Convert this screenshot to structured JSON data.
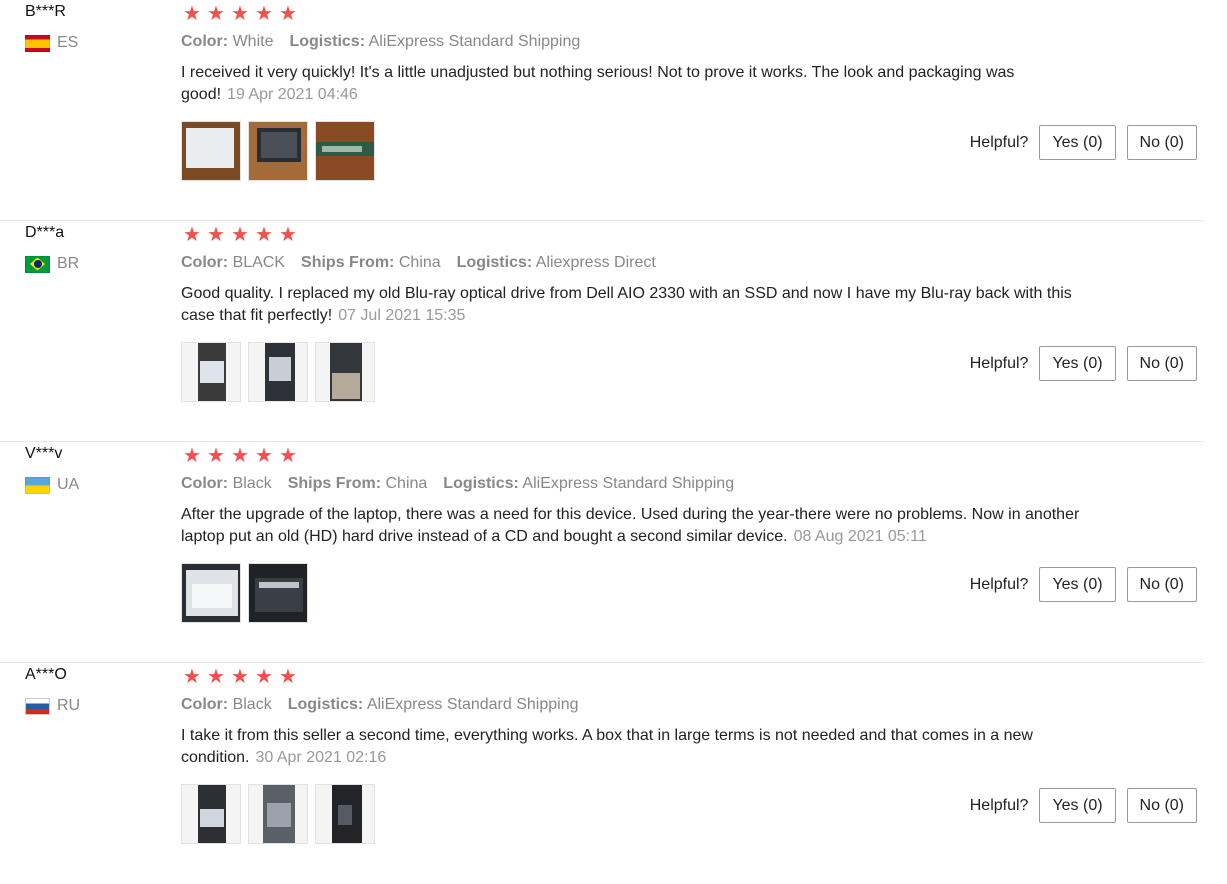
{
  "helpful_label": "Helpful?",
  "yes_label": "Yes (0)",
  "no_label": "No (0)",
  "star_glyph": "★",
  "reviews": [
    {
      "user": "B***R",
      "country": "ES",
      "flag": "es",
      "rating": 5,
      "attrs": [
        {
          "key": "Color:",
          "val": "White"
        },
        {
          "key": "Logistics:",
          "val": "AliExpress Standard Shipping"
        }
      ],
      "text": "I received it very quickly! It's a little unadjusted but nothing serious! Not to prove it works. The look and packaging was good!",
      "date": "19 Apr 2021 04:46",
      "thumb_icons": [
        "photo-white-drive-icon",
        "photo-drive-bay-icon",
        "photo-drive-connector-icon"
      ]
    },
    {
      "user": "D***a",
      "country": "BR",
      "flag": "br",
      "rating": 5,
      "attrs": [
        {
          "key": "Color:",
          "val": "BLACK"
        },
        {
          "key": "Ships From:",
          "val": "China"
        },
        {
          "key": "Logistics:",
          "val": "Aliexpress Direct"
        }
      ],
      "text": "Good quality. I replaced my old Blu-ray optical drive from Dell AIO 2330 with an SSD and now I have my Blu-ray back with this case that fit perfectly!",
      "date": "07 Jul 2021 15:35",
      "thumb_icons": [
        "photo-drive-box-icon",
        "photo-drive-angle-icon",
        "photo-drive-table-icon"
      ]
    },
    {
      "user": "V***v",
      "country": "UA",
      "flag": "ua",
      "rating": 5,
      "attrs": [
        {
          "key": "Color:",
          "val": "Black"
        },
        {
          "key": "Ships From:",
          "val": "China"
        },
        {
          "key": "Logistics:",
          "val": "AliExpress Standard Shipping"
        }
      ],
      "text": "After the upgrade of the laptop, there was a need for this device. Used during the year-there were no problems. Now in another laptop put an old (HD) hard drive instead of a CD and bought a second similar device.",
      "date": "08 Aug 2021 05:11",
      "thumb_icons": [
        "photo-drive-package-icon",
        "photo-drive-dark-box-icon"
      ]
    },
    {
      "user": "A***O",
      "country": "RU",
      "flag": "ru",
      "rating": 5,
      "attrs": [
        {
          "key": "Color:",
          "val": "Black"
        },
        {
          "key": "Logistics:",
          "val": "AliExpress Standard Shipping"
        }
      ],
      "text": "I take it from this seller a second time, everything works. A box that in large terms is not needed and that comes in a new condition.",
      "date": "30 Apr 2021 02:16",
      "thumb_icons": [
        "photo-drive-front-icon",
        "photo-drive-disc-icon",
        "photo-drive-back-icon"
      ]
    }
  ]
}
